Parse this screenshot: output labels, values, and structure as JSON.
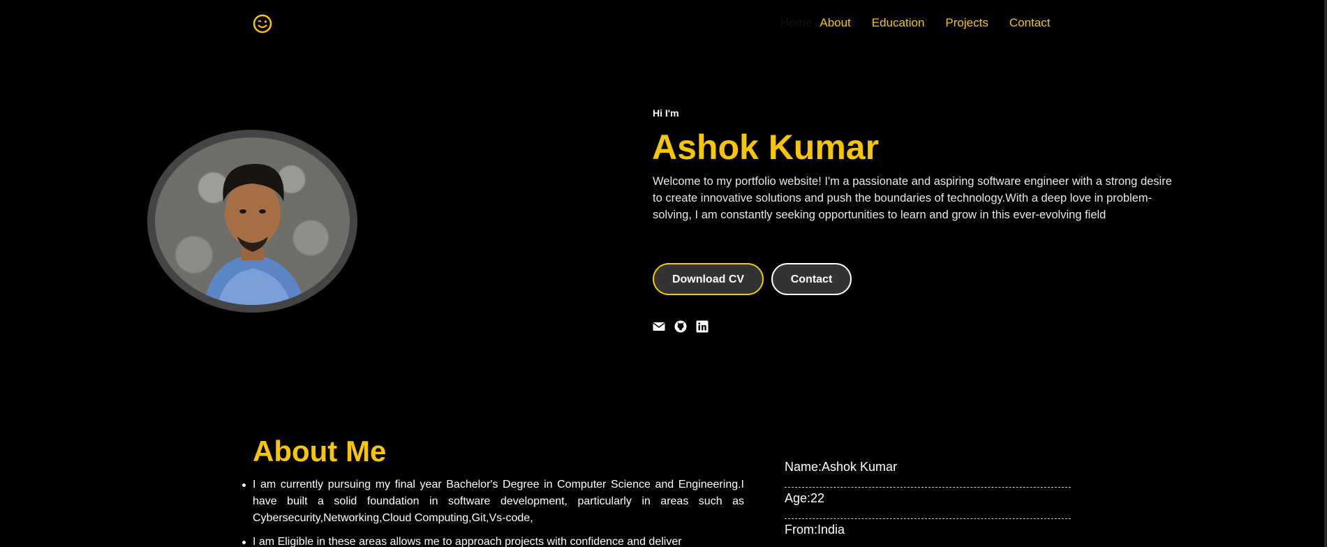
{
  "nav": {
    "home": "Home",
    "about": "About",
    "education": "Education",
    "projects": "Projects",
    "contact": "Contact"
  },
  "hero": {
    "greeting": "Hi I'm",
    "name": "Ashok Kumar",
    "intro": "Welcome to my portfolio website! I'm a passionate and aspiring software engineer with a strong desire to create innovative solutions and push the boundaries of technology.With a deep love in problem-solving, I am constantly seeking opportunities to learn and grow in this ever-evolving field",
    "download_cv": "Download CV",
    "contact": "Contact",
    "social_icons": [
      "email-icon",
      "github-icon",
      "linkedin-icon"
    ]
  },
  "about": {
    "title": "About Me",
    "items": [
      "I am currently pursuing my final year Bachelor's Degree in Computer Science and Engineering.I have built a solid foundation in software development, particularly in areas such as Cybersecurity,Networking,Cloud Computing,Git,Vs-code,",
      "I am Eligible in these areas allows me to approach projects with confidence and deliver"
    ],
    "info": [
      "Name:Ashok Kumar",
      "Age:22",
      "From:India"
    ]
  },
  "colors": {
    "accent": "#f7c600",
    "background": "#000000",
    "button_bg": "#333333"
  }
}
